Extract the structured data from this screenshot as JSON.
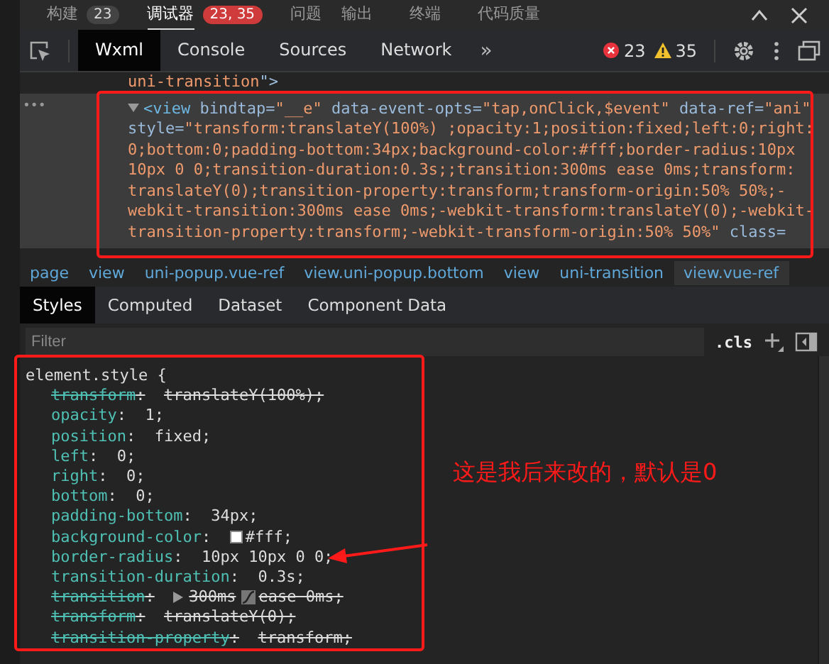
{
  "top_tabs": [
    {
      "label": "构建",
      "badge": "23",
      "alert": false,
      "selected": false
    },
    {
      "label": "调试器",
      "badge": "23, 35",
      "alert": true,
      "selected": true
    },
    {
      "label": "问题",
      "selected": false
    },
    {
      "label": "输出",
      "selected": false
    },
    {
      "label": "终端",
      "selected": false
    },
    {
      "label": "代码质量",
      "selected": false
    }
  ],
  "toolbar": {
    "tabs": [
      {
        "label": "Wxml",
        "selected": true
      },
      {
        "label": "Console",
        "selected": false
      },
      {
        "label": "Sources",
        "selected": false
      },
      {
        "label": "Network",
        "selected": false
      }
    ],
    "more": "»",
    "errors": "23",
    "warnings": "35"
  },
  "code": {
    "ellipsis": "•••",
    "lines": [
      {
        "selected": false,
        "arrow": false,
        "segments": [
          {
            "kind": "value",
            "text": "uni-transition"
          },
          {
            "kind": "attr",
            "text": "\">"
          }
        ]
      },
      {
        "selected": true,
        "arrow": true,
        "segments": [
          {
            "kind": "tag",
            "text": "<view"
          },
          {
            "kind": "attr",
            "text": " bindtap="
          },
          {
            "kind": "value",
            "text": "\"__e\""
          },
          {
            "kind": "attr",
            "text": " data-event-opts="
          },
          {
            "kind": "value",
            "text": "\"tap,onClick,$event\""
          },
          {
            "kind": "attr",
            "text": " data-ref="
          },
          {
            "kind": "value",
            "text": "\"ani\""
          }
        ]
      },
      {
        "selected": true,
        "arrow": false,
        "segments": [
          {
            "kind": "attr",
            "text": "style="
          },
          {
            "kind": "value",
            "text": "\"transform:translateY(100%) ;opacity:1;position:fixed;left:0;right:"
          }
        ]
      },
      {
        "selected": true,
        "arrow": false,
        "segments": [
          {
            "kind": "value",
            "text": "0;bottom:0;padding-bottom:34px;background-color:#fff;border-radius:10px"
          }
        ]
      },
      {
        "selected": true,
        "arrow": false,
        "segments": [
          {
            "kind": "value",
            "text": "10px 0 0;transition-duration:0.3s;;transition:300ms ease 0ms;transform:"
          }
        ]
      },
      {
        "selected": true,
        "arrow": false,
        "segments": [
          {
            "kind": "value",
            "text": "translateY(0);transition-property:transform;transform-origin:50% 50%;-"
          }
        ]
      },
      {
        "selected": true,
        "arrow": false,
        "segments": [
          {
            "kind": "value",
            "text": "webkit-transition:300ms ease 0ms;-webkit-transform:translateY(0);-webkit-"
          }
        ]
      },
      {
        "selected": true,
        "arrow": false,
        "segments": [
          {
            "kind": "value",
            "text": "transition-property:transform;-webkit-transform-origin:50% 50%\""
          },
          {
            "kind": "attr",
            "text": " class="
          }
        ]
      }
    ]
  },
  "breadcrumb": [
    {
      "label": "page",
      "selected": false
    },
    {
      "label": "view",
      "selected": false
    },
    {
      "label": "uni-popup.vue-ref",
      "selected": false
    },
    {
      "label": "view.uni-popup.bottom",
      "selected": false
    },
    {
      "label": "view",
      "selected": false
    },
    {
      "label": "uni-transition",
      "selected": false
    },
    {
      "label": "view.vue-ref",
      "selected": true
    }
  ],
  "style_tabs": [
    {
      "label": "Styles",
      "selected": true
    },
    {
      "label": "Computed",
      "selected": false
    },
    {
      "label": "Dataset",
      "selected": false
    },
    {
      "label": "Component Data",
      "selected": false
    }
  ],
  "filter": {
    "placeholder": "Filter",
    "cls": ".cls"
  },
  "rule": {
    "selector": "element.style {",
    "properties": [
      {
        "kind": "plain",
        "name": "transform",
        "colon": ":",
        "value": "translateY(100%);",
        "struck": true
      },
      {
        "kind": "plain",
        "name": "opacity",
        "colon": ":",
        "value": "1;",
        "struck": false
      },
      {
        "kind": "plain",
        "name": "position",
        "colon": ":",
        "value": "fixed;",
        "struck": false
      },
      {
        "kind": "plain",
        "name": "left",
        "colon": ":",
        "value": "0;",
        "struck": false
      },
      {
        "kind": "plain",
        "name": "right",
        "colon": ":",
        "value": "0;",
        "struck": false
      },
      {
        "kind": "plain",
        "name": "bottom",
        "colon": ":",
        "value": "0;",
        "struck": false
      },
      {
        "kind": "plain",
        "name": "padding-bottom",
        "colon": ":",
        "value": "34px;",
        "struck": false
      },
      {
        "kind": "color",
        "name": "background-color",
        "colon": ":",
        "value": "#fff;",
        "color": "#ffffff",
        "struck": false
      },
      {
        "kind": "plain",
        "name": "border-radius",
        "colon": ":",
        "value": "10px 10px 0 0;",
        "struck": false
      },
      {
        "kind": "plain",
        "name": "transition-duration",
        "colon": ":",
        "value": "0.3s;",
        "struck": false
      },
      {
        "kind": "transition",
        "name": "transition",
        "colon": ":",
        "value": "300ms",
        "value_2": "ease 0ms;",
        "struck": true
      },
      {
        "kind": "plain",
        "name": "transform",
        "colon": ":",
        "value": "translateY(0);",
        "struck": true
      },
      {
        "kind": "plain",
        "name": "transition-property",
        "colon": ":",
        "value": "transform;",
        "struck": true
      }
    ]
  },
  "annotation": {
    "note": "这是我后来改的，默认是0"
  }
}
